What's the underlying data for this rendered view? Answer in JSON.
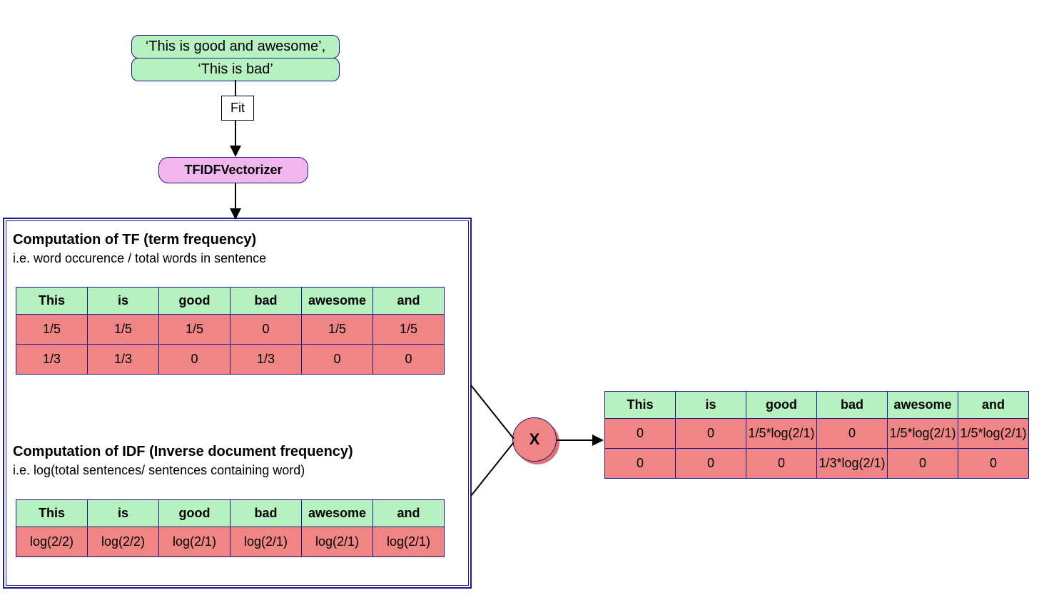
{
  "inputs": {
    "line1": "‘This is good and awesome’,",
    "line2": "‘This is bad’"
  },
  "fit_label": "Fit",
  "vectorizer": "TFIDFVectorizer",
  "tf": {
    "title": "Computation of TF (term frequency)",
    "subtitle": "i.e. word occurence / total words in sentence",
    "headers": [
      "This",
      "is",
      "good",
      "bad",
      "awesome",
      "and"
    ],
    "rows": [
      [
        "1/5",
        "1/5",
        "1/5",
        "0",
        "1/5",
        "1/5"
      ],
      [
        "1/3",
        "1/3",
        "0",
        "1/3",
        "0",
        "0"
      ]
    ]
  },
  "idf": {
    "title": "Computation of IDF (Inverse document frequency)",
    "subtitle": "i.e. log(total sentences/ sentences containing word)",
    "headers": [
      "This",
      "is",
      "good",
      "bad",
      "awesome",
      "and"
    ],
    "rows": [
      [
        "log(2/2)",
        "log(2/2)",
        "log(2/1)",
        "log(2/1)",
        "log(2/1)",
        "log(2/1)"
      ]
    ]
  },
  "multiply_symbol": "X",
  "result": {
    "headers": [
      "This",
      "is",
      "good",
      "bad",
      "awesome",
      "and"
    ],
    "rows": [
      [
        "0",
        "0",
        "1/5*log(2/1)",
        "0",
        "1/5*log(2/1)",
        "1/5*log(2/1)"
      ],
      [
        "0",
        "0",
        "0",
        "1/3*log(2/1)",
        "0",
        "0"
      ]
    ]
  }
}
